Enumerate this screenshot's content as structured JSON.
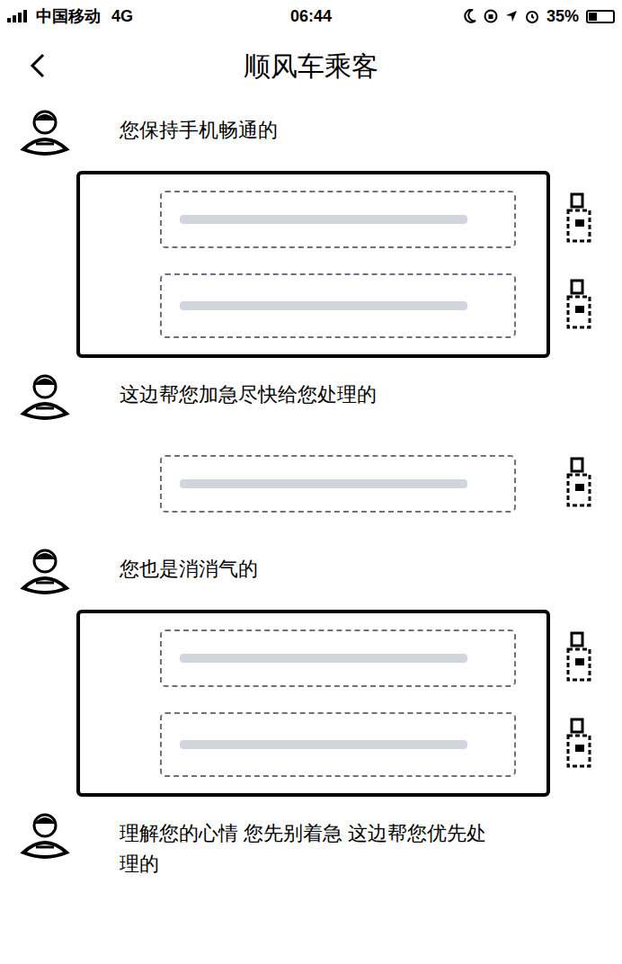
{
  "status_bar": {
    "carrier": "中国移动",
    "network": "4G",
    "time": "06:44",
    "battery": "35%",
    "battery_level": 0.35
  },
  "title": "顺风车乘客",
  "messages": [
    {
      "kind": "agent",
      "text": "您保持手机畅通的"
    },
    {
      "kind": "user",
      "highlighted": true
    },
    {
      "kind": "user-long",
      "highlighted": true
    },
    {
      "kind": "agent",
      "text": "这边帮您加急尽快给您处理的"
    },
    {
      "kind": "user",
      "highlighted": false
    },
    {
      "kind": "agent",
      "text": "您也是消消气的"
    },
    {
      "kind": "user",
      "highlighted": true
    },
    {
      "kind": "user-long",
      "highlighted": true
    },
    {
      "kind": "agent",
      "text": "理解您的心情 您先别着急 这边帮您优先处理的"
    }
  ]
}
